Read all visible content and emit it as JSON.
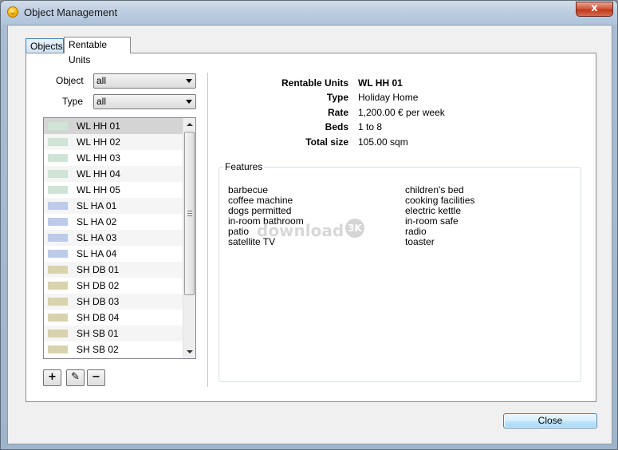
{
  "window": {
    "title": "Object Management",
    "close_glyph": "x"
  },
  "tabs": [
    {
      "label": "Objects"
    },
    {
      "label": "Rentable Units"
    }
  ],
  "filters": {
    "object_label": "Object",
    "object_value": "all",
    "type_label": "Type",
    "type_value": "all"
  },
  "units": [
    {
      "name": "WL HH 01",
      "color": "#cfe4d6"
    },
    {
      "name": "WL HH 02",
      "color": "#cfe4d6"
    },
    {
      "name": "WL HH 03",
      "color": "#cfe4d6"
    },
    {
      "name": "WL HH 04",
      "color": "#cfe4d6"
    },
    {
      "name": "WL HH 05",
      "color": "#cfe4d6"
    },
    {
      "name": "SL HA 01",
      "color": "#bccbe9"
    },
    {
      "name": "SL HA 02",
      "color": "#bccbe9"
    },
    {
      "name": "SL HA 03",
      "color": "#bccbe9"
    },
    {
      "name": "SL HA 04",
      "color": "#bccbe9"
    },
    {
      "name": "SH DB 01",
      "color": "#d8d3ad"
    },
    {
      "name": "SH DB 02",
      "color": "#d8d3ad"
    },
    {
      "name": "SH DB 03",
      "color": "#d8d3ad"
    },
    {
      "name": "SH DB 04",
      "color": "#d8d3ad"
    },
    {
      "name": "SH SB 01",
      "color": "#d8d3ad"
    },
    {
      "name": "SH SB 02",
      "color": "#d8d3ad"
    }
  ],
  "toolbar": {
    "add": "+",
    "edit": "✎",
    "remove": "−"
  },
  "details": {
    "unit_label": "Rentable Units",
    "unit_value": "WL HH 01",
    "type_label": "Type",
    "type_value": "Holiday Home",
    "rate_label": "Rate",
    "rate_value": "1,200.00 € per week",
    "beds_label": "Beds",
    "beds_value": "1 to 8",
    "size_label": "Total size",
    "size_value": "105.00 sqm"
  },
  "features": {
    "title": "Features",
    "col1": [
      "barbecue",
      "coffee machine",
      "dogs permitted",
      "in-room bathroom",
      "patio",
      "satellite TV"
    ],
    "col2": [
      "children's bed",
      "cooking facilities",
      "electric kettle",
      "in-room safe",
      "radio",
      "toaster"
    ]
  },
  "watermark": {
    "text": "download",
    "badge": "3K"
  },
  "footer": {
    "close_label": "Close"
  }
}
